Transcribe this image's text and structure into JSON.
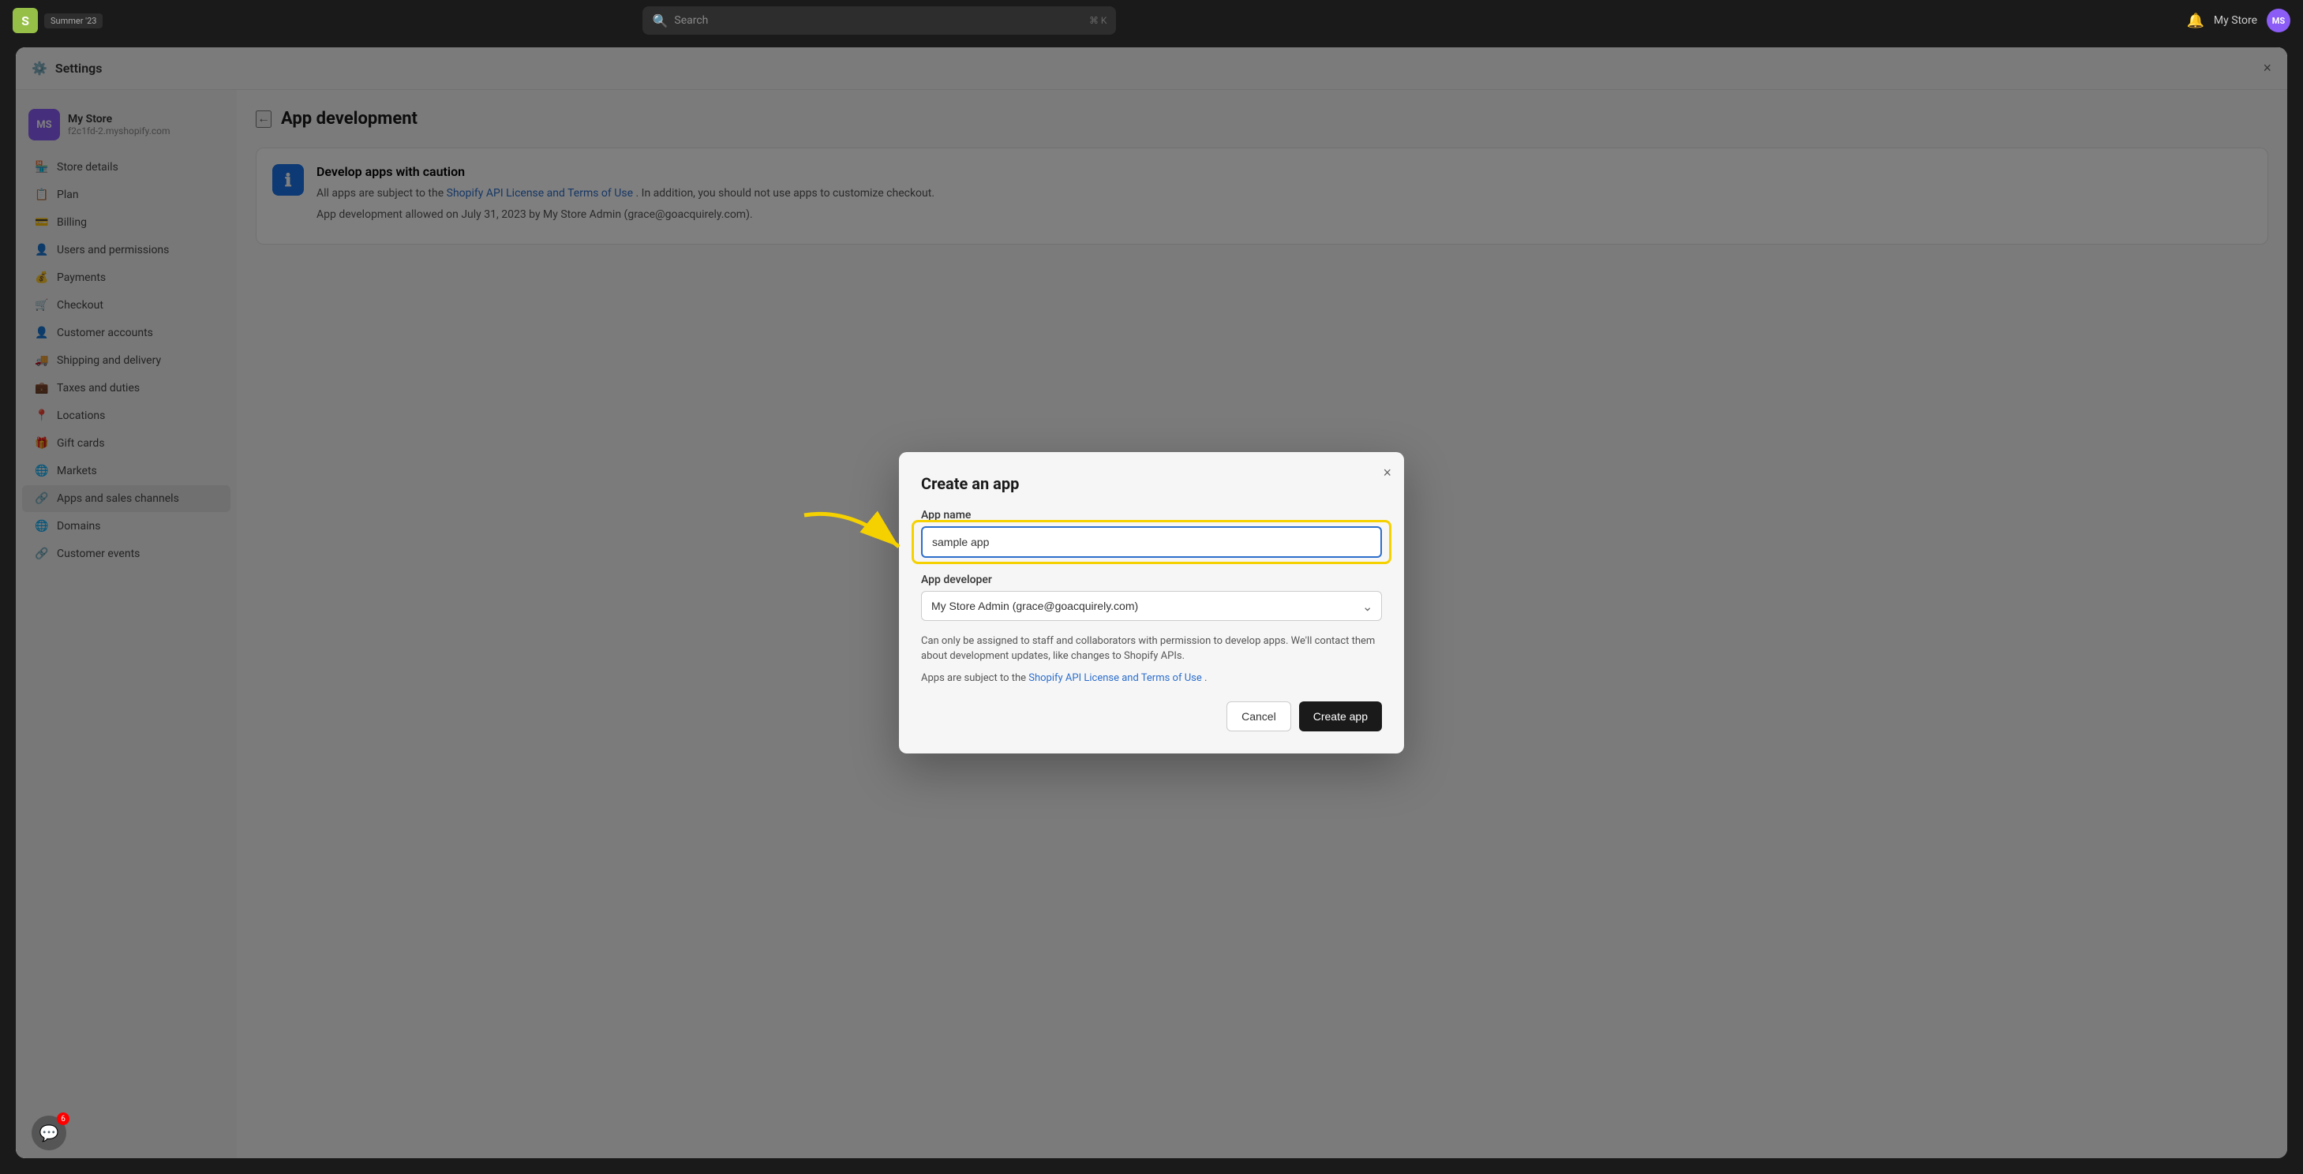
{
  "topbar": {
    "logo_text": "S",
    "summer_badge": "Summer '23",
    "search_placeholder": "Search",
    "search_shortcut": "⌘ K",
    "store_name": "My Store",
    "avatar_initials": "MS",
    "close_label": "×"
  },
  "settings": {
    "title": "Settings",
    "close_label": "×"
  },
  "store": {
    "avatar_initials": "MS",
    "name": "My Store",
    "url": "f2c1fd-2.myshopify.com"
  },
  "sidebar": {
    "items": [
      {
        "id": "store-details",
        "icon": "🏪",
        "label": "Store details"
      },
      {
        "id": "plan",
        "icon": "📋",
        "label": "Plan"
      },
      {
        "id": "billing",
        "icon": "💳",
        "label": "Billing"
      },
      {
        "id": "users",
        "icon": "👤",
        "label": "Users and permissions"
      },
      {
        "id": "payments",
        "icon": "💰",
        "label": "Payments"
      },
      {
        "id": "checkout",
        "icon": "🛒",
        "label": "Checkout"
      },
      {
        "id": "customer-accounts",
        "icon": "👤",
        "label": "Customer accounts"
      },
      {
        "id": "shipping",
        "icon": "🚚",
        "label": "Shipping and delivery"
      },
      {
        "id": "taxes",
        "icon": "💼",
        "label": "Taxes and duties"
      },
      {
        "id": "locations",
        "icon": "📍",
        "label": "Locations"
      },
      {
        "id": "gift-cards",
        "icon": "🎁",
        "label": "Gift cards"
      },
      {
        "id": "markets",
        "icon": "🌐",
        "label": "Markets"
      },
      {
        "id": "apps-channels",
        "icon": "🔗",
        "label": "Apps and sales channels"
      },
      {
        "id": "domains",
        "icon": "🌐",
        "label": "Domains"
      },
      {
        "id": "customer-events",
        "icon": "🔗",
        "label": "Customer events"
      }
    ]
  },
  "page": {
    "back_label": "←",
    "title": "App development"
  },
  "caution_card": {
    "title": "Develop apps with caution",
    "text1": "All apps are subject to the",
    "link1_text": "Shopify API License and Terms of Use",
    "link1_href": "#",
    "text1_end": ". In addition, you should not use apps to customize checkout.",
    "text2": "App development allowed on July 31, 2023 by My Store Admin (grace@goacquirely.com)."
  },
  "modal": {
    "title": "Create an app",
    "close_label": "×",
    "app_name_label": "App name",
    "app_name_value": "sample app",
    "app_developer_label": "App developer",
    "app_developer_value": "My Store Admin (grace@goacquirely.com)",
    "helper_text": "Can only be assigned to staff and collaborators with permission to develop apps. We'll contact them about development updates, like changes to Shopify APIs.",
    "terms_text_pre": "Apps are subject to the",
    "terms_link_text": "Shopify API License and Terms of Use",
    "terms_text_end": ".",
    "cancel_label": "Cancel",
    "create_label": "Create app"
  },
  "chat_badge": "6"
}
